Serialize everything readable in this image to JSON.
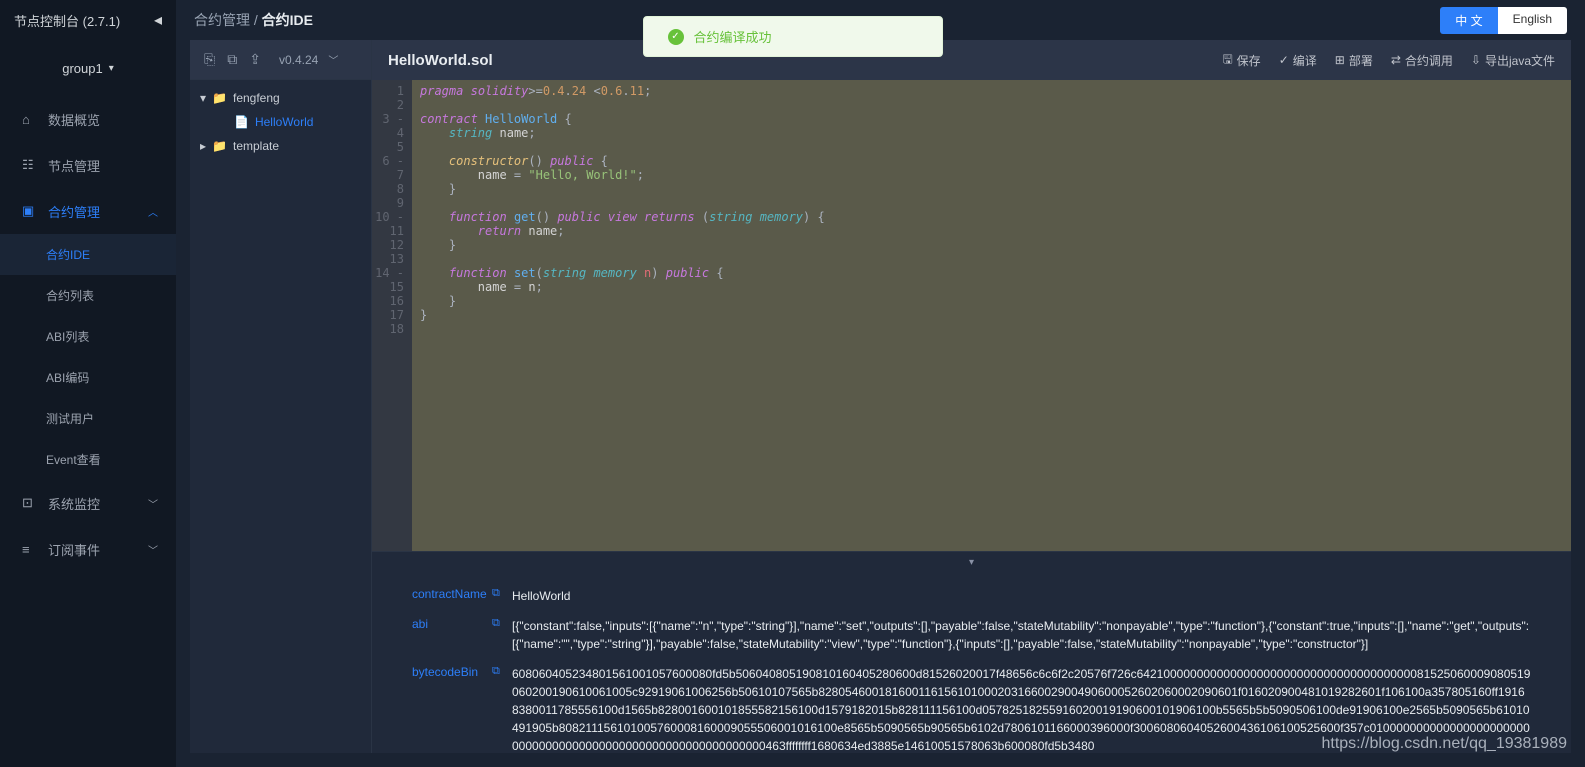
{
  "header": {
    "title": "节点控制台 (2.7.1)"
  },
  "group": {
    "label": "group1"
  },
  "sidebar": {
    "items": [
      {
        "icon": "⌂",
        "label": "数据概览"
      },
      {
        "icon": "📅",
        "label": "节点管理"
      },
      {
        "icon": "▣",
        "label": "合约管理",
        "active": true,
        "expanded": true
      },
      {
        "icon": "⊞",
        "label": "系统监控",
        "collapsible": true
      },
      {
        "icon": "≡",
        "label": "订阅事件",
        "collapsible": true
      }
    ],
    "subitems": [
      {
        "label": "合约IDE",
        "active": true
      },
      {
        "label": "合约列表"
      },
      {
        "label": "ABI列表"
      },
      {
        "label": "ABI编码"
      },
      {
        "label": "测试用户"
      },
      {
        "label": "Event查看"
      }
    ]
  },
  "breadcrumb": {
    "parent": "合约管理",
    "current": "合约IDE"
  },
  "lang": {
    "zh": "中 文",
    "en": "English"
  },
  "version": "v0.4.24",
  "tree": {
    "folders": [
      {
        "name": "fengfeng",
        "open": true,
        "files": [
          {
            "name": "HelloWorld",
            "active": true
          }
        ]
      },
      {
        "name": "template",
        "open": false
      }
    ]
  },
  "filename": "HelloWorld.sol",
  "toolbar": {
    "save": "保存",
    "compile": "编译",
    "deploy": "部署",
    "call": "合约调用",
    "export": "导出java文件"
  },
  "toast": {
    "text": "合约编译成功"
  },
  "code_lines": [
    "1",
    "2",
    "3",
    "4",
    "5",
    "6",
    "7",
    "8",
    "9",
    "10",
    "11",
    "12",
    "13",
    "14",
    "15",
    "16",
    "17",
    "18"
  ],
  "gutter_marks": {
    "3": "-",
    "6": "-",
    "10": "-",
    "14": "-"
  },
  "info": {
    "contractName": {
      "label": "contractName",
      "value": "HelloWorld"
    },
    "abi": {
      "label": "abi",
      "value": "[{\"constant\":false,\"inputs\":[{\"name\":\"n\",\"type\":\"string\"}],\"name\":\"set\",\"outputs\":[],\"payable\":false,\"stateMutability\":\"nonpayable\",\"type\":\"function\"},{\"constant\":true,\"inputs\":[],\"name\":\"get\",\"outputs\":[{\"name\":\"\",\"type\":\"string\"}],\"payable\":false,\"stateMutability\":\"view\",\"type\":\"function\"},{\"inputs\":[],\"payable\":false,\"stateMutability\":\"nonpayable\",\"type\":\"constructor\"}]"
    },
    "bytecodeBin": {
      "label": "bytecodeBin",
      "value": "608060405234801561001057600080fd5b506040805190810160405280600d81526020017f48656c6c6f2c20576f726c64210000000000000000000000000000000000000081525060009080519060200190610061005c92919061006256b50610107565b828054600181600116156101000203166002900490600052602060002090601f016020900481019282601f106100a357805160ff19168380011785556100d1565b828001600101855582156100d1579182015b828111156100d05782518255916020019190600101906100b5565b5b5090506100de91906100e2565b5090565b61010491905b808211156101005760008160009055506001016100e8565b5090565b90565b6102d7806101166000396000f3006080604052600436106100525600f357c01000000000000000000000000000000000000000000000000000000000000463ffffffff1680634ed3885e14610051578063b600080fd5b3480"
    }
  },
  "watermark": "https://blog.csdn.net/qq_19381989"
}
